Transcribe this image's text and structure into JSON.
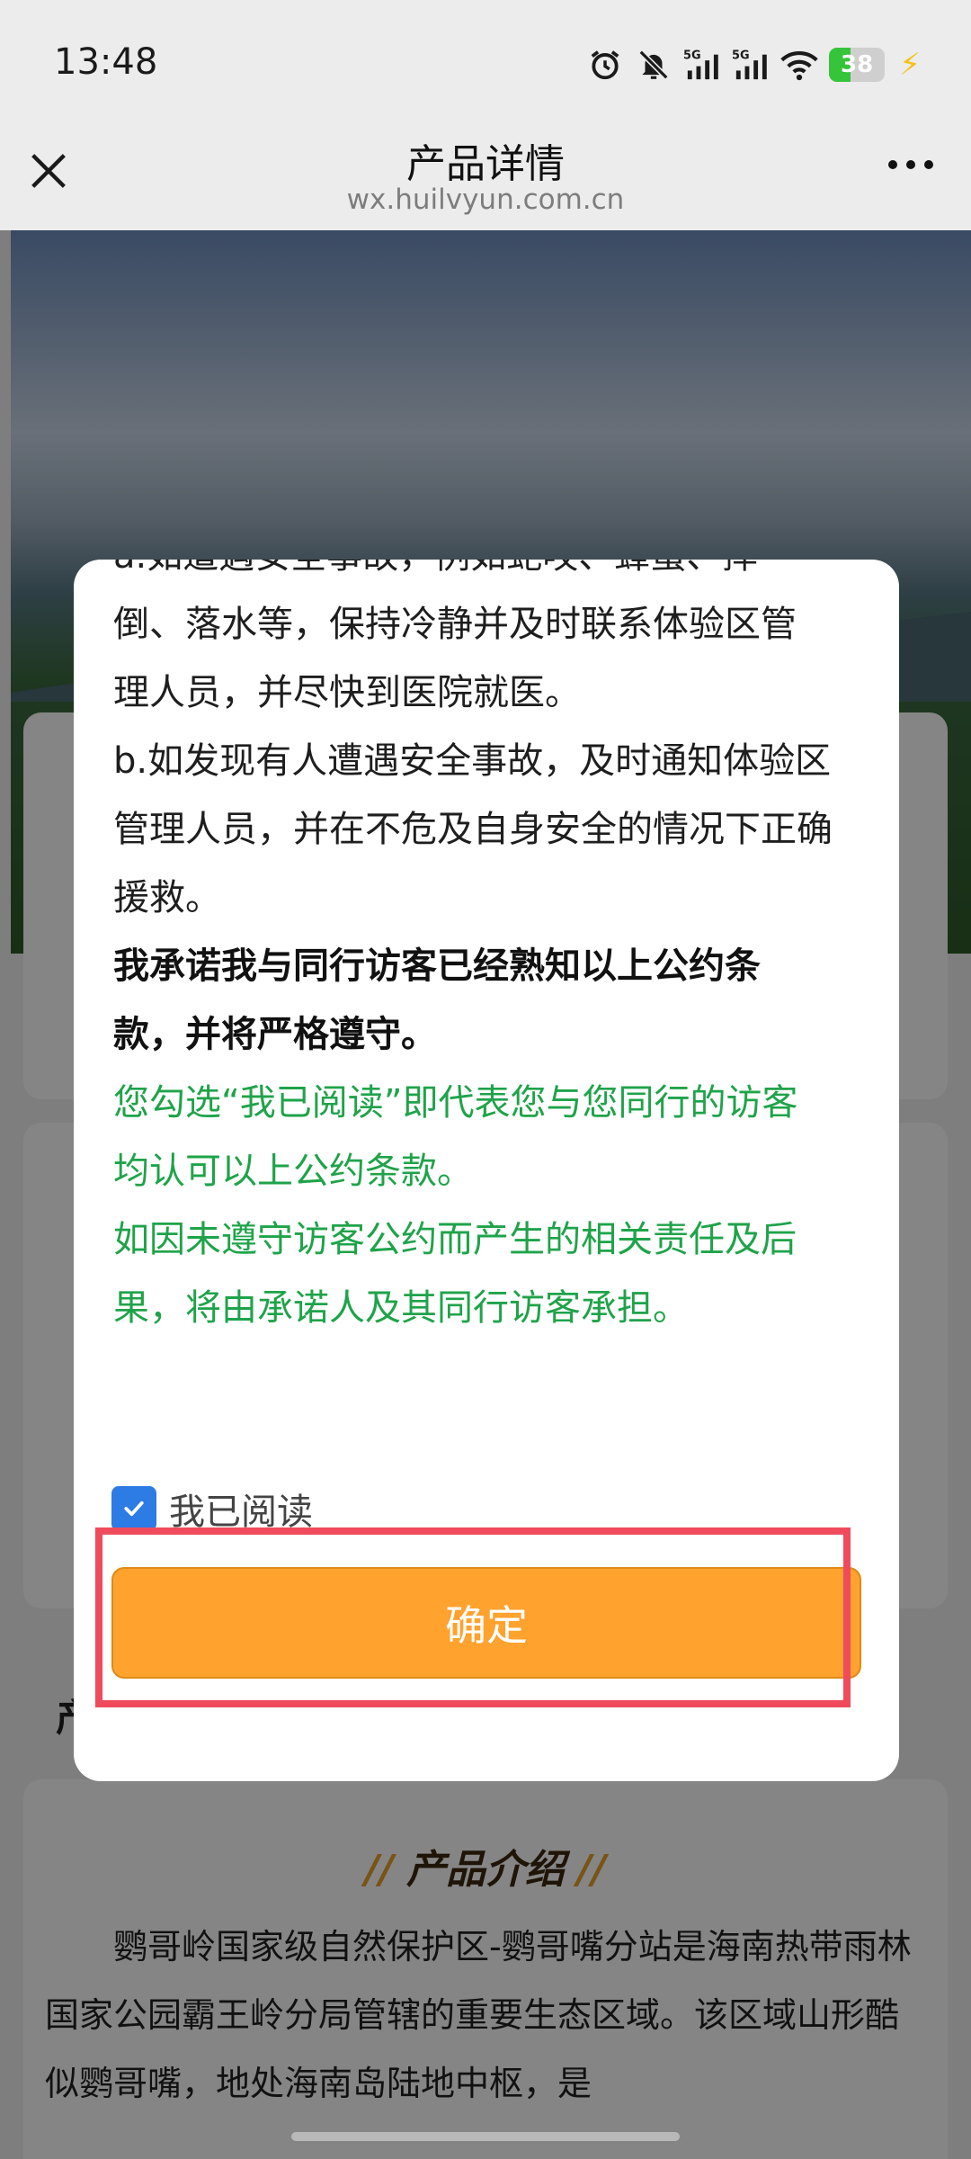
{
  "status_bar": {
    "time": "13:48",
    "battery_level": "38",
    "icons": [
      "alarm-icon",
      "mute-bell-icon",
      "signal-5g-icon",
      "signal-5g-icon",
      "wifi-icon",
      "battery-icon",
      "charging-bolt-icon"
    ]
  },
  "nav": {
    "title": "产品详情",
    "url": "wx.huilvyun.com.cn"
  },
  "modal": {
    "lines_normal_1": [
      "a.如遭遇安全事故，例如蛇咬、蜂蜇、摔",
      "倒、落水等，保持冷静并及时联系体验区管",
      "理人员，并尽快到医院就医。",
      "b.如发现有人遭遇安全事故，及时通知体验区",
      "管理人员，并在不危及自身安全的情况下正确",
      "援救。"
    ],
    "lines_bold": [
      "我承诺我与同行访客已经熟知以上公约条",
      "款，并将严格遵守。"
    ],
    "lines_green": [
      "您勾选“我已阅读”即代表您与您同行的访客",
      "均认可以上公约条款。",
      "如因未遵守访客公约而产生的相关责任及后",
      "果，将由承诺人及其同行访客承担。"
    ],
    "checkbox_label": "我已阅读",
    "checkbox_checked": true,
    "confirm_label": "确定"
  },
  "page": {
    "section_heading": "产",
    "intro_title": "产品介绍",
    "intro_deco": "//",
    "intro_text": "鹦哥岭国家级自然保护区-鹦哥嘴分站是海南热带雨林国家公园霸王岭分局管辖的重要生态区域。该区域山形酷似鹦哥嘴，地处海南岛陆地中枢，是"
  },
  "colors": {
    "accent_orange": "#ffa22e",
    "green_text": "#1fa34a",
    "checkbox_blue": "#2d7be5",
    "highlight_red": "#ef4b5c"
  }
}
